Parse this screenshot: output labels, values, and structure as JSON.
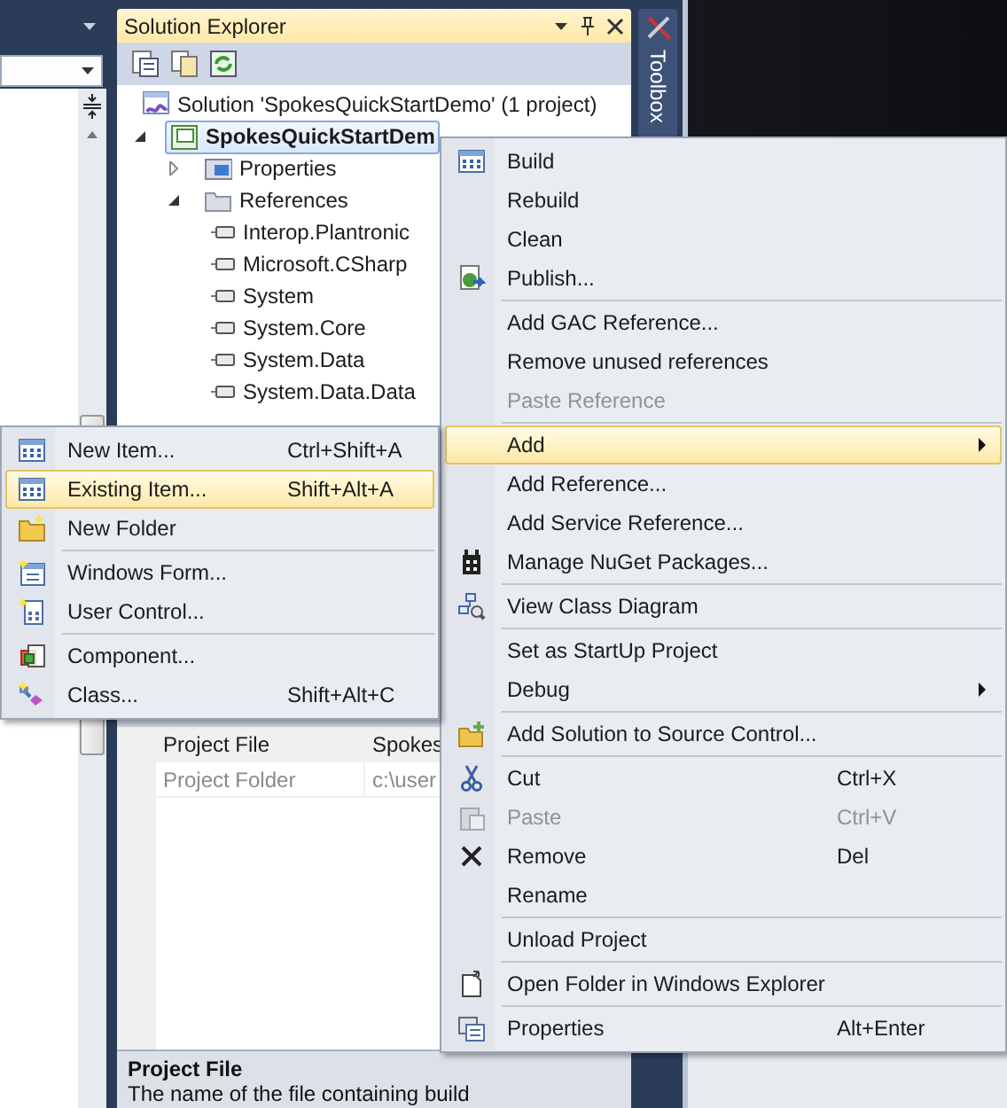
{
  "solution_explorer": {
    "title": "Solution Explorer",
    "tree": [
      {
        "label": "Solution 'SpokesQuickStartDemo' (1 project)",
        "selected": false,
        "children": [
          {
            "label": "SpokesQuickStartDem",
            "selected": true,
            "expanded": true,
            "children": [
              {
                "label": "Properties",
                "selected": false,
                "expanded": false
              },
              {
                "label": "References",
                "selected": false,
                "expanded": true,
                "children": [
                  {
                    "label": "Interop.Plantronic",
                    "selected": false
                  },
                  {
                    "label": "Microsoft.CSharp",
                    "selected": false
                  },
                  {
                    "label": "System",
                    "selected": false
                  },
                  {
                    "label": "System.Core",
                    "selected": false
                  },
                  {
                    "label": "System.Data",
                    "selected": false
                  },
                  {
                    "label": "System.Data.Data",
                    "selected": false
                  }
                ]
              }
            ]
          }
        ]
      }
    ],
    "properties": [
      {
        "name": "Project File",
        "value": "Spokes",
        "disabled": false
      },
      {
        "name": "Project Folder",
        "value": "c:\\user",
        "disabled": true
      }
    ],
    "description": {
      "title": "Project File",
      "text": "The name of the file containing build"
    }
  },
  "toolbox": {
    "label": "Toolbox"
  },
  "context_menu": {
    "groups": [
      {
        "items": [
          {
            "label": "Build",
            "selected": false,
            "disabled": false,
            "has_submenu": false
          },
          {
            "label": "Rebuild",
            "selected": false,
            "disabled": false,
            "has_submenu": false
          },
          {
            "label": "Clean",
            "selected": false,
            "disabled": false,
            "has_submenu": false
          },
          {
            "label": "Publish...",
            "selected": false,
            "disabled": false,
            "has_submenu": false
          }
        ]
      },
      {
        "items": [
          {
            "label": "Add GAC Reference...",
            "selected": false,
            "disabled": false,
            "has_submenu": false
          },
          {
            "label": "Remove unused references",
            "selected": false,
            "disabled": false,
            "has_submenu": false
          },
          {
            "label": "Paste Reference",
            "selected": false,
            "disabled": true,
            "has_submenu": false
          }
        ]
      },
      {
        "items": [
          {
            "label": "Add",
            "selected": true,
            "disabled": false,
            "has_submenu": true
          },
          {
            "label": "Add Reference...",
            "selected": false,
            "disabled": false,
            "has_submenu": false
          },
          {
            "label": "Add Service Reference...",
            "selected": false,
            "disabled": false,
            "has_submenu": false
          },
          {
            "label": "Manage NuGet Packages...",
            "selected": false,
            "disabled": false,
            "has_submenu": false
          }
        ]
      },
      {
        "items": [
          {
            "label": "View Class Diagram",
            "selected": false,
            "disabled": false,
            "has_submenu": false
          }
        ]
      },
      {
        "items": [
          {
            "label": "Set as StartUp Project",
            "selected": false,
            "disabled": false,
            "has_submenu": false
          },
          {
            "label": "Debug",
            "selected": false,
            "disabled": false,
            "has_submenu": true
          }
        ]
      },
      {
        "items": [
          {
            "label": "Add Solution to Source Control...",
            "selected": false,
            "disabled": false,
            "has_submenu": false
          }
        ]
      },
      {
        "items": [
          {
            "label": "Cut",
            "shortcut": "Ctrl+X",
            "selected": false,
            "disabled": false,
            "has_submenu": false
          },
          {
            "label": "Paste",
            "shortcut": "Ctrl+V",
            "selected": false,
            "disabled": true,
            "has_submenu": false
          },
          {
            "label": "Remove",
            "shortcut": "Del",
            "selected": false,
            "disabled": false,
            "has_submenu": false
          },
          {
            "label": "Rename",
            "selected": false,
            "disabled": false,
            "has_submenu": false
          }
        ]
      },
      {
        "items": [
          {
            "label": "Unload Project",
            "selected": false,
            "disabled": false,
            "has_submenu": false
          }
        ]
      },
      {
        "items": [
          {
            "label": "Open Folder in Windows Explorer",
            "selected": false,
            "disabled": false,
            "has_submenu": false
          }
        ]
      },
      {
        "items": [
          {
            "label": "Properties",
            "shortcut": "Alt+Enter",
            "selected": false,
            "disabled": false,
            "has_submenu": false
          }
        ]
      }
    ]
  },
  "add_submenu": {
    "groups": [
      {
        "items": [
          {
            "label": "New Item...",
            "shortcut": "Ctrl+Shift+A",
            "selected": false
          },
          {
            "label": "Existing Item...",
            "shortcut": "Shift+Alt+A",
            "selected": true
          },
          {
            "label": "New Folder",
            "selected": false
          }
        ]
      },
      {
        "items": [
          {
            "label": "Windows Form...",
            "selected": false
          },
          {
            "label": "User Control...",
            "selected": false
          }
        ]
      },
      {
        "items": [
          {
            "label": "Component...",
            "selected": false
          },
          {
            "label": "Class...",
            "shortcut": "Shift+Alt+C",
            "selected": false
          }
        ]
      }
    ]
  }
}
